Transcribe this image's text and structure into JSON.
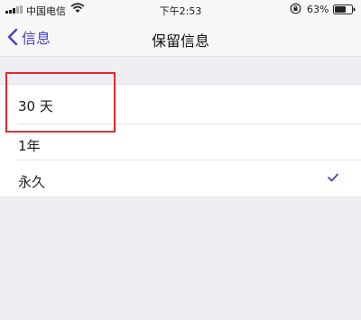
{
  "status_bar": {
    "carrier": "中国电信",
    "time": "下午2:53",
    "battery_percent": "63%"
  },
  "nav": {
    "back_label": "信息",
    "title": "保留信息"
  },
  "options": [
    {
      "label": "30 天",
      "selected": false
    },
    {
      "label": "1年",
      "selected": false
    },
    {
      "label": "永久",
      "selected": true
    }
  ],
  "colors": {
    "accent": "#4a40c8",
    "highlight": "#e8262c",
    "background": "#efeef3"
  }
}
